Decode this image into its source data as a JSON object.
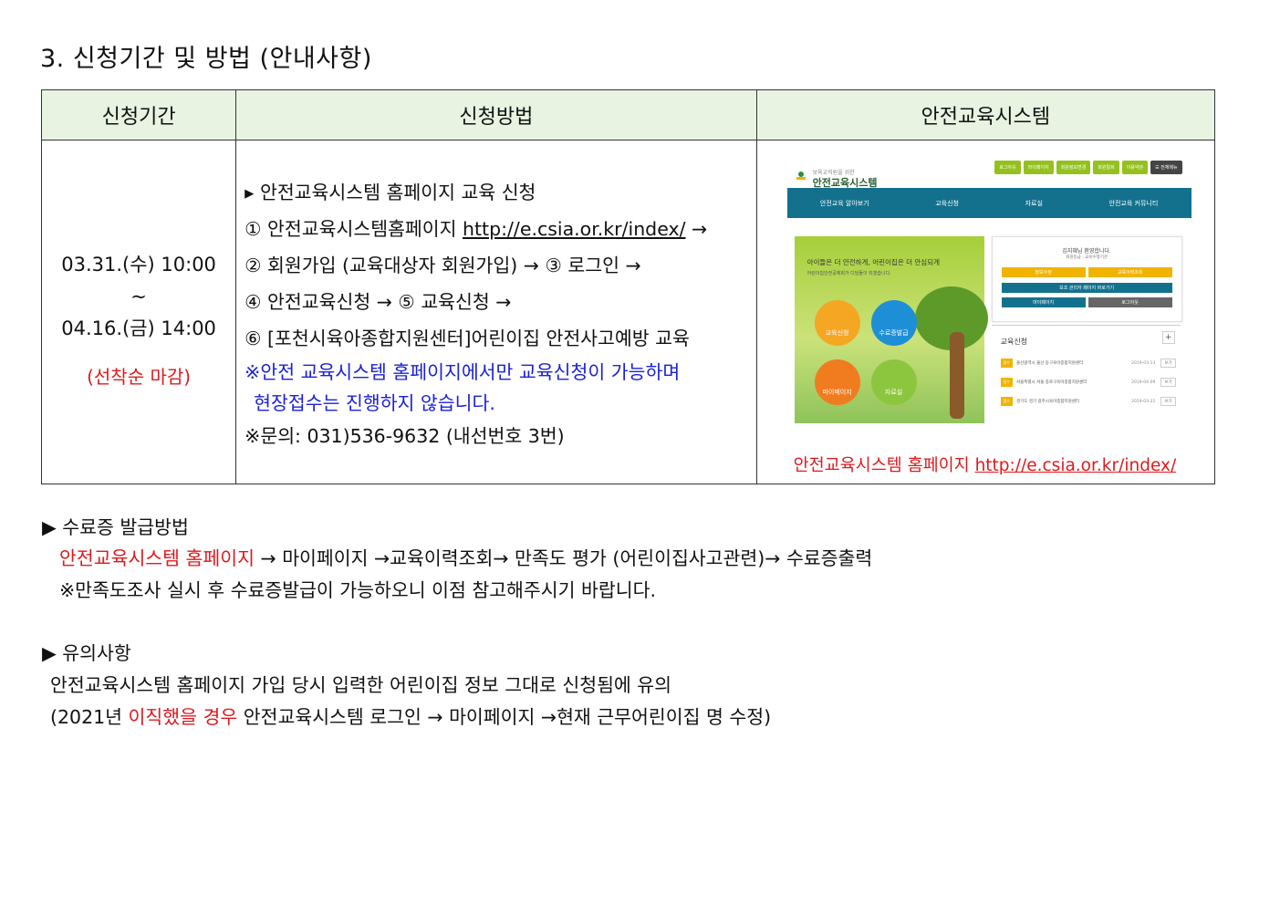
{
  "title": "3. 신청기간 및 방법 (안내사항)",
  "table": {
    "headers": [
      "신청기간",
      "신청방법",
      "안전교육시스템"
    ],
    "period": {
      "start": "03.31.(수) 10:00",
      "tilde": "~",
      "end": "04.16.(금) 14:00",
      "note": "(선착순 마감)"
    },
    "method": {
      "line1": "▸ 안전교육시스템 홈페이지 교육 신청",
      "line2_prefix": "① 안전교육시스템홈페이지 ",
      "line2_url": "http://e.csia.or.kr/index/",
      "line2_suffix": " →",
      "line3": "② 회원가입 (교육대상자 회원가입) → ③ 로그인 →",
      "line4": "④ 안전교육신청 → ⑤ 교육신청 →",
      "line5": "⑥ [포천시육아종합지원센터]어린이집 안전사고예방 교육",
      "notice1": "※안전 교육시스템 홈페이지에서만 교육신청이 가능하며",
      "notice2": "현장접수는 진행하지 않습니다.",
      "contact": "※문의: 031)536-9632 (내선번호 3번)"
    },
    "screenshot": {
      "logo_sub": "보육교직원을 위한",
      "logo": "안전교육시스템",
      "top_buttons": [
        "로그아웃",
        "마이페이지",
        "회원정보변경",
        "회원탈퇴",
        "이용약관",
        "☰ 전체메뉴"
      ],
      "nav": [
        "안전교육 알아보기",
        "교육신청",
        "자료실",
        "안전교육 커뮤니티"
      ],
      "hero_title": "아이들은 더 안전하게, 어린이집은 더 안심되게",
      "hero_sub": "어린이집안전공제회가 디딤돌이 되겠습니다.",
      "circles": [
        "교육신청",
        "수료증발급",
        "마이페이지",
        "자료실"
      ],
      "welcome": "김지혜님 환영합니다.",
      "grade": "회원등급 : 교육수행기관",
      "panel_buttons": [
        "정보수정",
        "교육이력조회",
        "보조 관리자 페이지 바로가기",
        "마이페이지",
        "로그아웃"
      ],
      "edu_title": "교육신청",
      "edu_plus": "+",
      "edu_rows": [
        {
          "tag": "접수",
          "name": "울산광역시 울산 동구육아종합지원센터",
          "date": "2019-03-13",
          "btn": "보기"
        },
        {
          "tag": "접수",
          "name": "서울특별시 서울 종로구육아종합지원센터",
          "date": "2019-04-09",
          "btn": "보기"
        },
        {
          "tag": "접수",
          "name": "경기도 경기 광주시육아종합지원센터",
          "date": "2019-03-21",
          "btn": "보기"
        }
      ]
    },
    "caption_prefix": "안전교육시스템 홈페이지 ",
    "caption_url": "http://e.csia.or.kr/index/"
  },
  "cert": {
    "heading": "▶ 수료증 발급방법",
    "line1_red": "안전교육시스템 홈페이지",
    "line1_rest": " → 마이페이지 →교육이력조회→ 만족도 평가 (어린이집사고관련)→ 수료증출력",
    "line2": "※만족도조사 실시 후 수료증발급이 가능하오니 이점 참고해주시기 바랍니다."
  },
  "notes": {
    "heading": "▶ 유의사항",
    "line1": "안전교육시스템 홈페이지 가입 당시 입력한 어린이집 정보 그대로 신청됨에 유의",
    "line2_a": "(2021년 ",
    "line2_red": "이직했을 경우",
    "line2_b": " 안전교육시스템 로그인 → 마이페이지 →현재 근무어린이집 명 수정)"
  },
  "colors": {
    "accent_red": "#e0191e",
    "accent_blue": "#1b21d8",
    "header_bg": "#e8f3e2",
    "nav_teal": "#14718e"
  }
}
